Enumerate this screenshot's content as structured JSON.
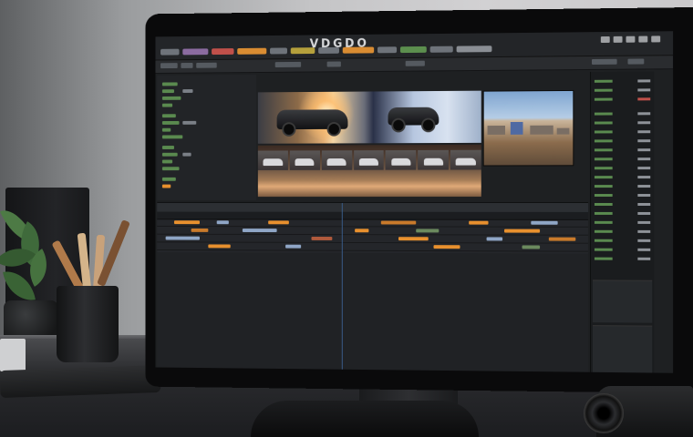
{
  "screen": {
    "app_title": "VDGDO",
    "accent": "#e8902e",
    "track_colors": [
      "#e8902e",
      "#c97a2b",
      "#8fa6c6",
      "#6b8a5e",
      "#b05a3c"
    ],
    "panel_green": "#5a8a4f"
  },
  "scene": {
    "objects": [
      "monitor",
      "plant",
      "pencil-cup",
      "speaker",
      "camera",
      "desk"
    ]
  }
}
